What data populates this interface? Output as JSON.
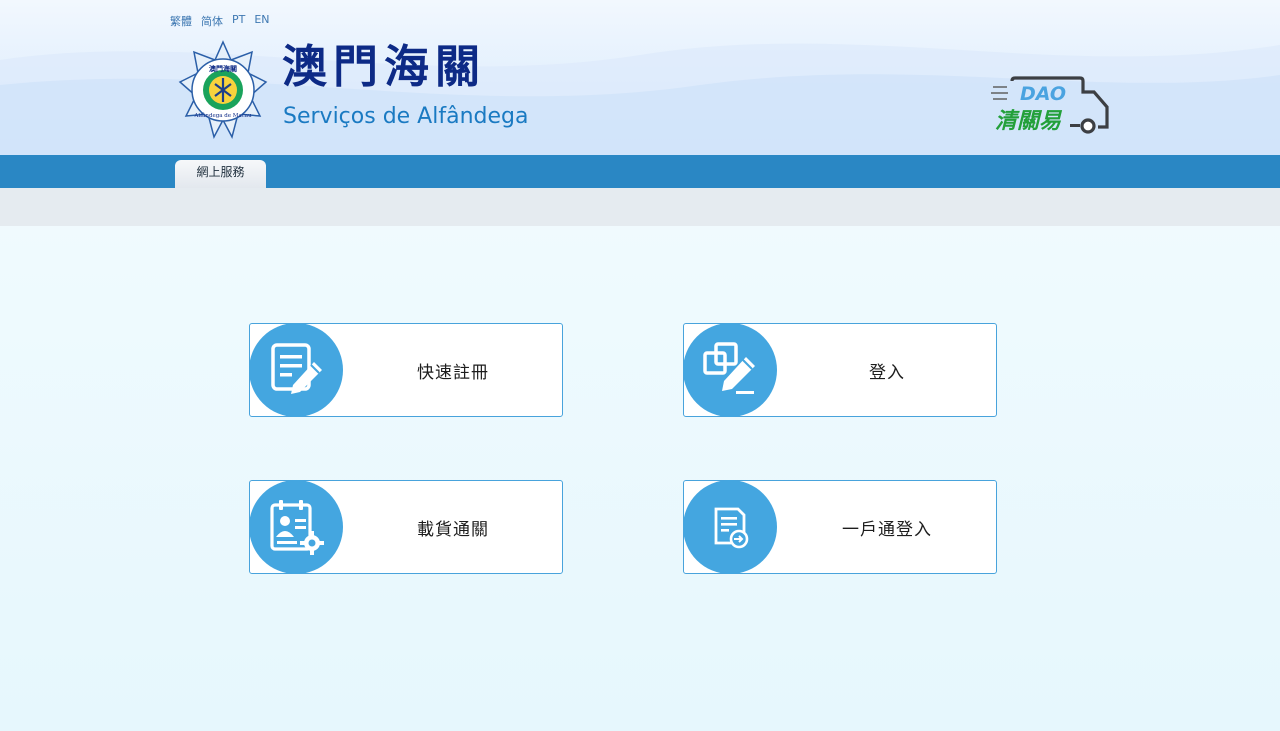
{
  "languages": [
    "繁體",
    "简体",
    "PT",
    "EN"
  ],
  "logo": {
    "chinese": "澳門海關",
    "portuguese": "Serviços de Alfândega",
    "emblem_text": "Alfândega de Macau",
    "emblem_chars": "澳門海關"
  },
  "brand": {
    "dao": "DAO",
    "chinese": "清關易"
  },
  "nav": {
    "tabs": [
      {
        "label": "網上服務"
      }
    ]
  },
  "tiles": [
    {
      "label": "快速註冊",
      "icon": "register-form-icon"
    },
    {
      "label": "登入",
      "icon": "login-edit-icon"
    },
    {
      "label": "載貨通關",
      "icon": "cargo-clearance-icon"
    },
    {
      "label": "一戶通登入",
      "icon": "one-account-login-icon"
    }
  ],
  "colors": {
    "nav": "#2a87c4",
    "tile_circle": "#44a6e0",
    "tile_border": "#48a3dc",
    "logo_navy": "#0d2a86",
    "logo_blue": "#1a7ac2",
    "brand_green": "#23a03a"
  }
}
